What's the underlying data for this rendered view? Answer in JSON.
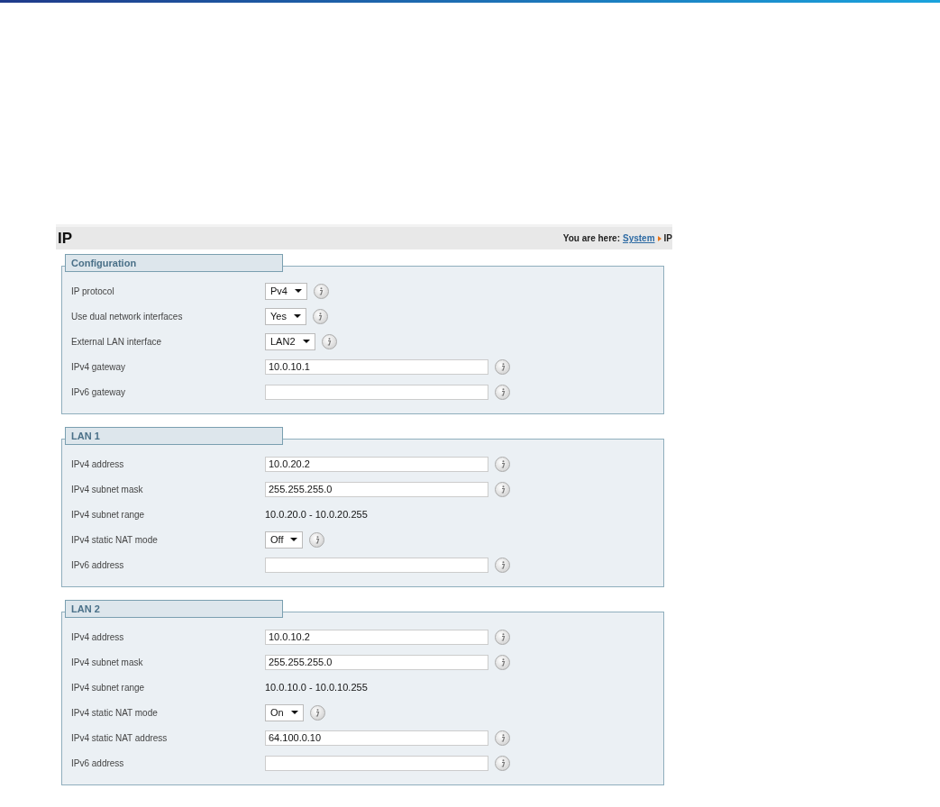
{
  "page_title": "IP",
  "breadcrumb": {
    "prefix": "You are here:",
    "link": "System",
    "current": "IP"
  },
  "sections": [
    {
      "title": "Configuration",
      "rows": [
        {
          "label": "IP protocol",
          "kind": "select",
          "value": "Pv4"
        },
        {
          "label": "Use dual network interfaces",
          "kind": "select",
          "value": "Yes"
        },
        {
          "label": "External LAN interface",
          "kind": "select",
          "value": "LAN2"
        },
        {
          "label": "IPv4 gateway",
          "kind": "input",
          "value": "10.0.10.1"
        },
        {
          "label": "IPv6 gateway",
          "kind": "input",
          "value": ""
        }
      ]
    },
    {
      "title": "LAN 1",
      "rows": [
        {
          "label": "IPv4 address",
          "kind": "input",
          "value": "10.0.20.2"
        },
        {
          "label": "IPv4 subnet mask",
          "kind": "input",
          "value": "255.255.255.0"
        },
        {
          "label": "IPv4 subnet range",
          "kind": "static",
          "value": "10.0.20.0 - 10.0.20.255"
        },
        {
          "label": "IPv4 static NAT mode",
          "kind": "select",
          "value": "Off"
        },
        {
          "label": "IPv6 address",
          "kind": "input",
          "value": ""
        }
      ]
    },
    {
      "title": "LAN 2",
      "rows": [
        {
          "label": "IPv4 address",
          "kind": "input",
          "value": "10.0.10.2"
        },
        {
          "label": "IPv4 subnet mask",
          "kind": "input",
          "value": "255.255.255.0"
        },
        {
          "label": "IPv4 subnet range",
          "kind": "static",
          "value": "10.0.10.0 - 10.0.10.255"
        },
        {
          "label": "IPv4 static NAT mode",
          "kind": "select",
          "value": "On"
        },
        {
          "label": "IPv4 static NAT address",
          "kind": "input",
          "value": "64.100.0.10"
        },
        {
          "label": "IPv6 address",
          "kind": "input",
          "value": ""
        }
      ]
    }
  ]
}
